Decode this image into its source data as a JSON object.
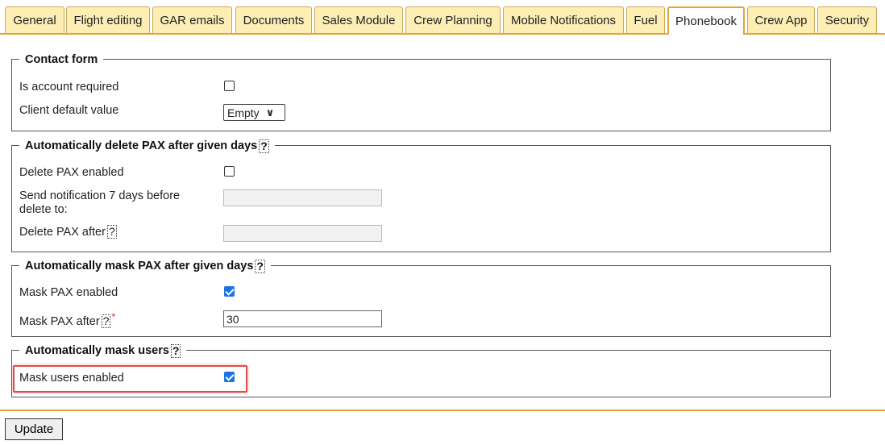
{
  "tabs": [
    {
      "label": "General"
    },
    {
      "label": "Flight editing"
    },
    {
      "label": "GAR emails"
    },
    {
      "label": "Documents"
    },
    {
      "label": "Sales Module"
    },
    {
      "label": "Crew Planning"
    },
    {
      "label": "Mobile Notifications"
    },
    {
      "label": "Fuel"
    },
    {
      "label": "Phonebook"
    },
    {
      "label": "Crew App"
    },
    {
      "label": "Security"
    }
  ],
  "active_tab": "Phonebook",
  "contact_form": {
    "legend": "Contact form",
    "account_required_label": "Is account required",
    "account_required_checked": false,
    "client_default_label": "Client default value",
    "client_default_value": "Empty"
  },
  "delete_pax": {
    "legend": "Automatically delete PAX after given days",
    "help": "?",
    "enabled_label": "Delete PAX enabled",
    "enabled_checked": false,
    "notify_label_line1": "Send notification 7 days before",
    "notify_label_line2": "delete to:",
    "notify_value": "",
    "after_label": "Delete PAX after",
    "after_help": "?",
    "after_value": ""
  },
  "mask_pax": {
    "legend": "Automatically mask PAX after given days",
    "help": "?",
    "enabled_label": "Mask PAX enabled",
    "enabled_checked": true,
    "after_label": "Mask PAX after",
    "after_help": "?",
    "required_mark": "*",
    "after_value": "30"
  },
  "mask_users": {
    "legend": "Automatically mask users",
    "help": "?",
    "enabled_label": "Mask users enabled",
    "enabled_checked": true
  },
  "update_button": "Update",
  "colors": {
    "tab_bg": "#fdeeb6",
    "accent": "#e8a23a",
    "checkbox": "#1a73e8",
    "highlight": "#e24b4b"
  }
}
